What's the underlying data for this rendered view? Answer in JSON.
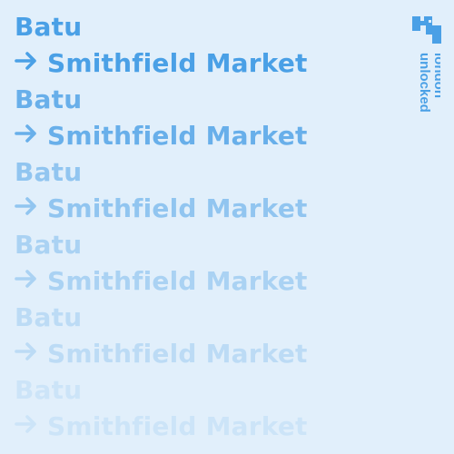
{
  "route_lines": [
    {
      "text": "Batu",
      "arrow": false
    },
    {
      "text": "Smithfield Market",
      "arrow": true
    },
    {
      "text": "Batu",
      "arrow": false
    },
    {
      "text": "Smithfield Market",
      "arrow": true
    },
    {
      "text": "Batu",
      "arrow": false
    },
    {
      "text": "Smithfield Market",
      "arrow": true
    },
    {
      "text": "Batu",
      "arrow": false
    },
    {
      "text": "Smithfield Market",
      "arrow": true
    },
    {
      "text": "Batu",
      "arrow": false
    },
    {
      "text": "Smithfield Market",
      "arrow": true
    },
    {
      "text": "Batu",
      "arrow": false
    },
    {
      "text": "Smithfield Market",
      "arrow": true
    }
  ],
  "brand": {
    "name": "london unlocked",
    "line1": "london",
    "line2": "unlocked",
    "logo_icon": "key-puzzle-mark"
  },
  "colors": {
    "background": "#e1effb",
    "text": "#4aa0e6",
    "brand": "#4aa0e6"
  }
}
